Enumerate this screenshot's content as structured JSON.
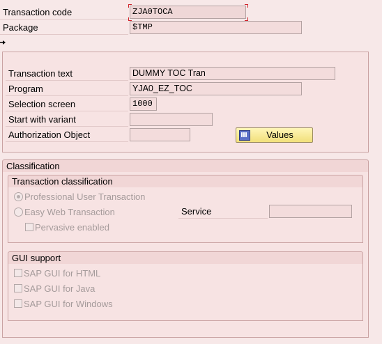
{
  "header": {
    "transaction_code": {
      "label": "Transaction code",
      "value": "ZJA0TOCA"
    },
    "package": {
      "label": "Package",
      "value": "$TMP"
    }
  },
  "details": {
    "transaction_text": {
      "label": "Transaction text",
      "value": "DUMMY TOC Tran"
    },
    "program": {
      "label": "Program",
      "value": "YJA0_EZ_TOC"
    },
    "selection_screen": {
      "label": "Selection screen",
      "value": "1000"
    },
    "start_with_variant": {
      "label": "Start with variant",
      "value": ""
    },
    "authorization_object": {
      "label": "Authorization Object",
      "value": ""
    },
    "values_button": {
      "label": "Values",
      "icon": "values-table-icon"
    }
  },
  "classification": {
    "title": "Classification",
    "transaction_classification": {
      "title": "Transaction classification",
      "professional": {
        "label": "Professional User Transaction",
        "selected": true
      },
      "easy_web": {
        "label": "Easy Web Transaction",
        "selected": false
      },
      "service": {
        "label": "Service",
        "value": ""
      },
      "pervasive": {
        "label": "Pervasive enabled",
        "checked": false
      }
    },
    "gui_support": {
      "title": "GUI support",
      "html": {
        "label": "SAP GUI for HTML",
        "checked": false
      },
      "java": {
        "label": "SAP GUI for Java",
        "checked": false
      },
      "windows": {
        "label": "SAP GUI for Windows",
        "checked": false
      }
    }
  },
  "colors": {
    "background": "#f7e8e8",
    "field": "#f3dcdc",
    "button": "#f1df7a",
    "focus_marker": "#d0222a"
  }
}
